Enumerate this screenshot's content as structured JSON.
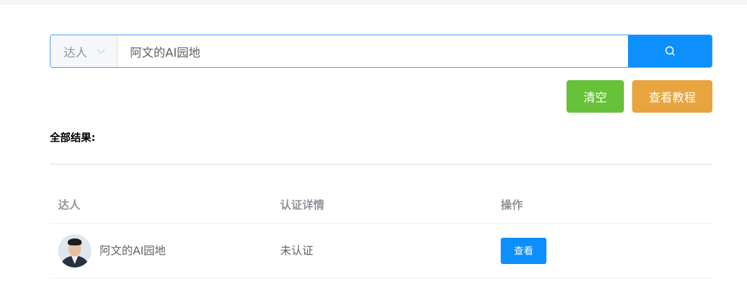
{
  "search": {
    "type_label": "达人",
    "query": "阿文的AI园地"
  },
  "actions": {
    "clear_label": "清空",
    "tutorial_label": "查看教程"
  },
  "results": {
    "title": "全部结果:",
    "columns": [
      "达人",
      "认证详情",
      "操作"
    ],
    "rows": [
      {
        "name": "阿文的AI园地",
        "cert_status": "未认证",
        "action_label": "查看"
      }
    ]
  },
  "colors": {
    "primary": "#0e8ffe",
    "success": "#67c23a",
    "warning": "#e8a43e",
    "border_focus": "#409eff"
  }
}
